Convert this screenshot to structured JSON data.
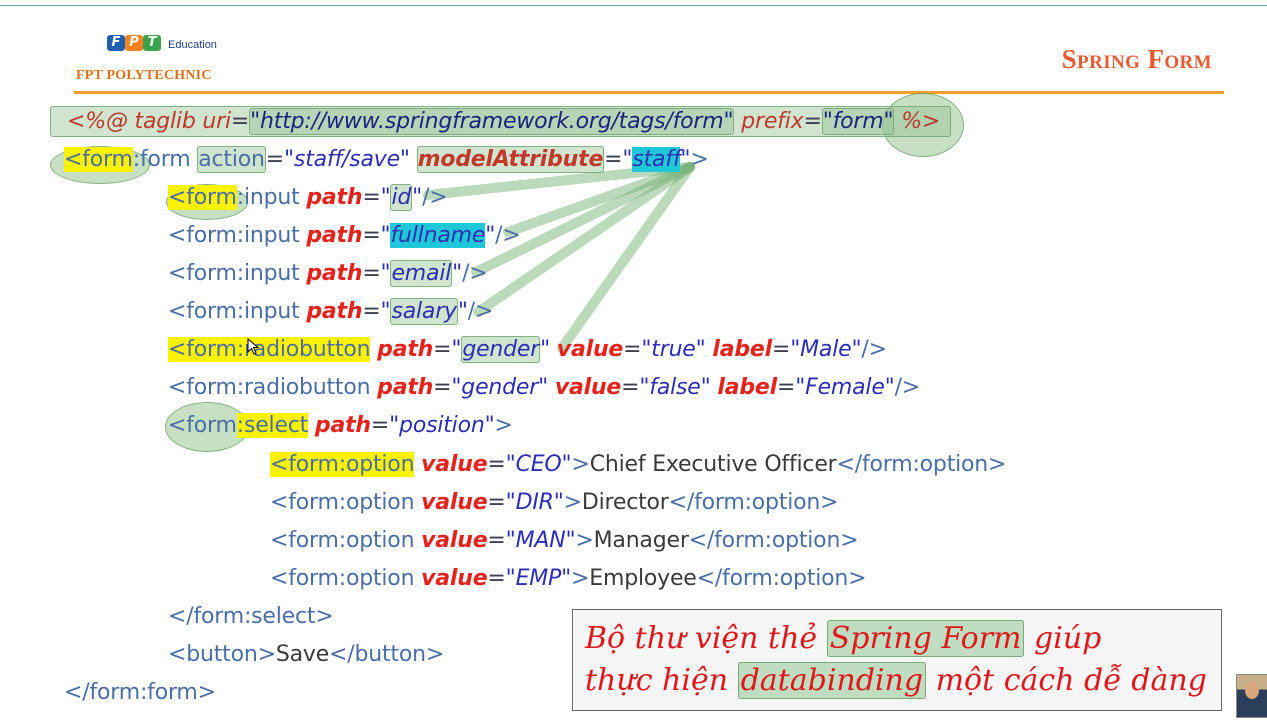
{
  "header": {
    "logo_letters": [
      "F",
      "P",
      "T"
    ],
    "edu_label": "Education",
    "org_name": "FPT POLYTECHNIC",
    "slide_title": "Spring Form"
  },
  "code": {
    "l1": {
      "open": "<%@ ",
      "taglib": "taglib",
      "uri_attr": "uri",
      "eq1": "=",
      "uri_val": "\"http://www.springframework.org/tags/form\"",
      "prefix_attr": "prefix",
      "eq2": "=",
      "prefix_val": "\"form\"",
      "close": " %>"
    },
    "l2": {
      "open": "<form",
      "tag": ":form",
      "action_attr": "action",
      "eq1": "=",
      "action_val": "\"staff/save\"",
      "ma_attr": "modelAttribute",
      "eq2": "=",
      "q1": "\"",
      "ma_val": "staff",
      "q2": "\"",
      "close": ">"
    },
    "l3": {
      "open": "<form",
      "tag": ":input",
      "attr": "path",
      "eq": "=",
      "q1": "\"",
      "val": "id",
      "q2": "\"",
      "close": "/>"
    },
    "l4": {
      "open": "<form:input ",
      "attr": "path",
      "eq": "=",
      "q1": "\"",
      "val": "fullname",
      "q2": "\"",
      "close": "/>"
    },
    "l5": {
      "open": "<form:input ",
      "attr": "path",
      "eq": "=",
      "q1": "\"",
      "val": "email",
      "q2": "\"",
      "close": "/>"
    },
    "l6": {
      "open": "<form:input ",
      "attr": "path",
      "eq": "=",
      "q1": "\"",
      "val": "salary",
      "q2": "\"",
      "close": "/>"
    },
    "l7": {
      "open": "<form",
      "tag": ":radiobutton",
      "attr": "path",
      "eq1": "=",
      "q1": "\"",
      "val": "gender",
      "q2": "\"",
      "value_attr": "value",
      "eq2": "=",
      "value_val": "\"true\"",
      "label_attr": "label",
      "eq3": "=",
      "label_val": "\"Male\"",
      "close": "/>"
    },
    "l8": {
      "open": "<form:radiobutton ",
      "attr": "path",
      "eq1": "=",
      "val": "\"gender\"",
      "value_attr": "value",
      "eq2": "=",
      "value_val": "\"false\"",
      "label_attr": "label",
      "eq3": "=",
      "label_val": "\"Female\"",
      "close": "/>"
    },
    "l9": {
      "open": "<form",
      "tag": ":select",
      "attr": "path",
      "eq": "=",
      "val": "\"position\"",
      "close": ">"
    },
    "options": [
      {
        "open": "<form:option",
        "attr": "value",
        "eq": "=",
        "val": "\"CEO\"",
        "gt": ">",
        "text": "Chief Executive Officer",
        "close": "</form:option>"
      },
      {
        "open": "<form:option ",
        "attr": "value",
        "eq": "=",
        "val": "\"DIR\"",
        "gt": ">",
        "text": "Director",
        "close": "</form:option>"
      },
      {
        "open": "<form:option ",
        "attr": "value",
        "eq": "=",
        "val": "\"MAN\"",
        "gt": ">",
        "text": "Manager",
        "close": "</form:option>"
      },
      {
        "open": "<form:option ",
        "attr": "value",
        "eq": "=",
        "val": "\"EMP\"",
        "gt": ">",
        "text": "Employee",
        "close": "</form:option>"
      }
    ],
    "l14": {
      "text": "</form:select>"
    },
    "l15": {
      "open": "<button>",
      "text": "Save",
      "close": "</button>"
    },
    "l16": {
      "text": "</form:form>"
    }
  },
  "callout": {
    "part1": "Bộ thư viện thẻ ",
    "highlight1": "Spring Form",
    "part2": " giúp",
    "part3": "thực hiện ",
    "highlight2": "databinding",
    "part4": " một cách dễ dàng"
  },
  "colors": {
    "keyword_red": "#e4241c",
    "value_blue": "#2b2fb4",
    "highlight_yellow": "#fff200",
    "highlight_cyan": "#1ec8d8",
    "title_orange": "#e85a32",
    "rule_orange": "#f0a02a"
  }
}
